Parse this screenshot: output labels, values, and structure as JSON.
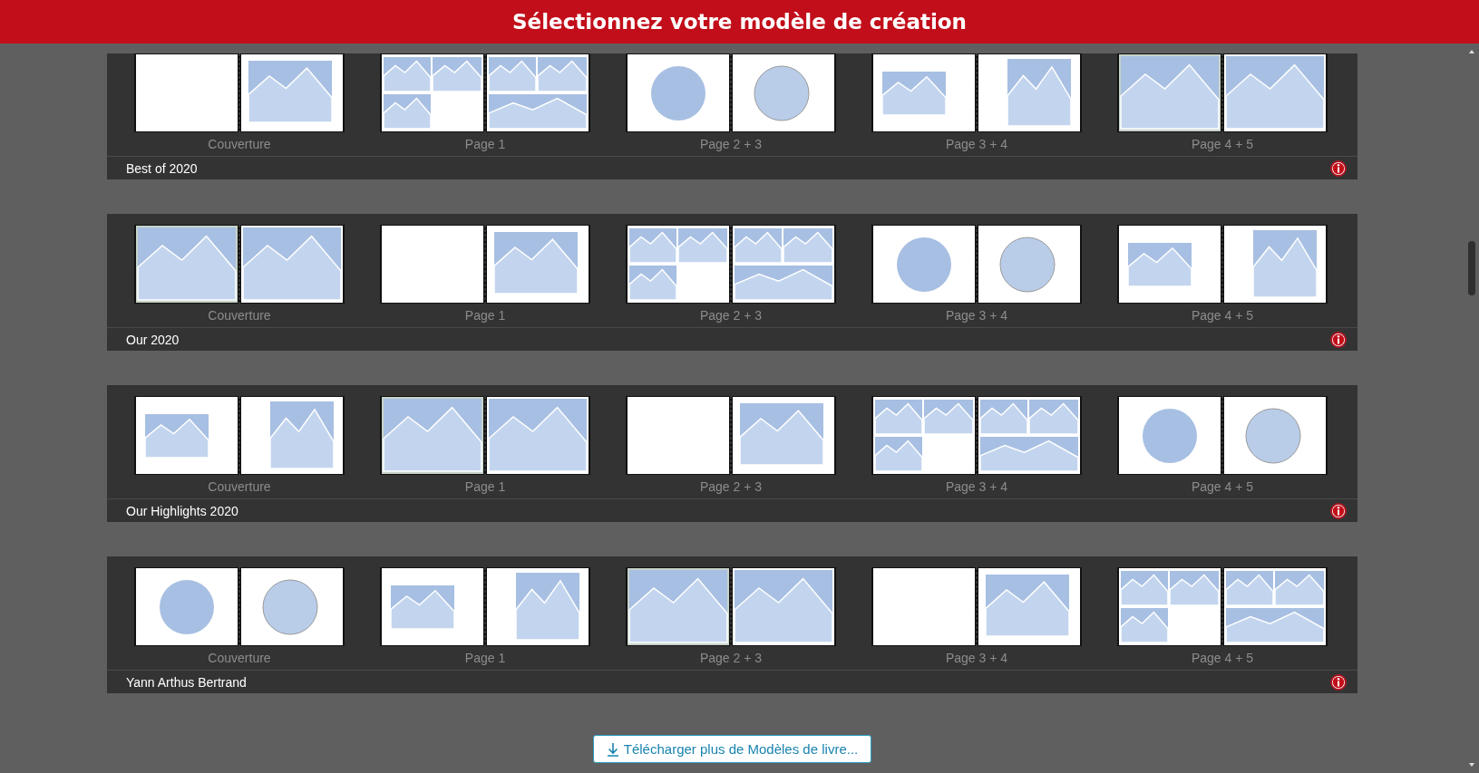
{
  "header": {
    "title": "Sélectionnez votre modèle de création"
  },
  "templates": [
    {
      "name": "Best of 2020",
      "pages": [
        "Couverture",
        "Page 1",
        "Page 2 + 3",
        "Page 3 + 4",
        "Page 4 + 5"
      ]
    },
    {
      "name": "Our 2020",
      "pages": [
        "Couverture",
        "Page 1",
        "Page 2 + 3",
        "Page 3 + 4",
        "Page 4 + 5"
      ]
    },
    {
      "name": "Our Highlights 2020",
      "pages": [
        "Couverture",
        "Page 1",
        "Page 2 + 3",
        "Page 3 + 4",
        "Page 4 + 5"
      ]
    },
    {
      "name": "Yann Arthus Bertrand",
      "pages": [
        "Couverture",
        "Page 1",
        "Page 2 + 3",
        "Page 3 + 4",
        "Page 4 + 5"
      ]
    }
  ],
  "download_button": {
    "label": "Télécharger plus de Modèles de livre..."
  }
}
